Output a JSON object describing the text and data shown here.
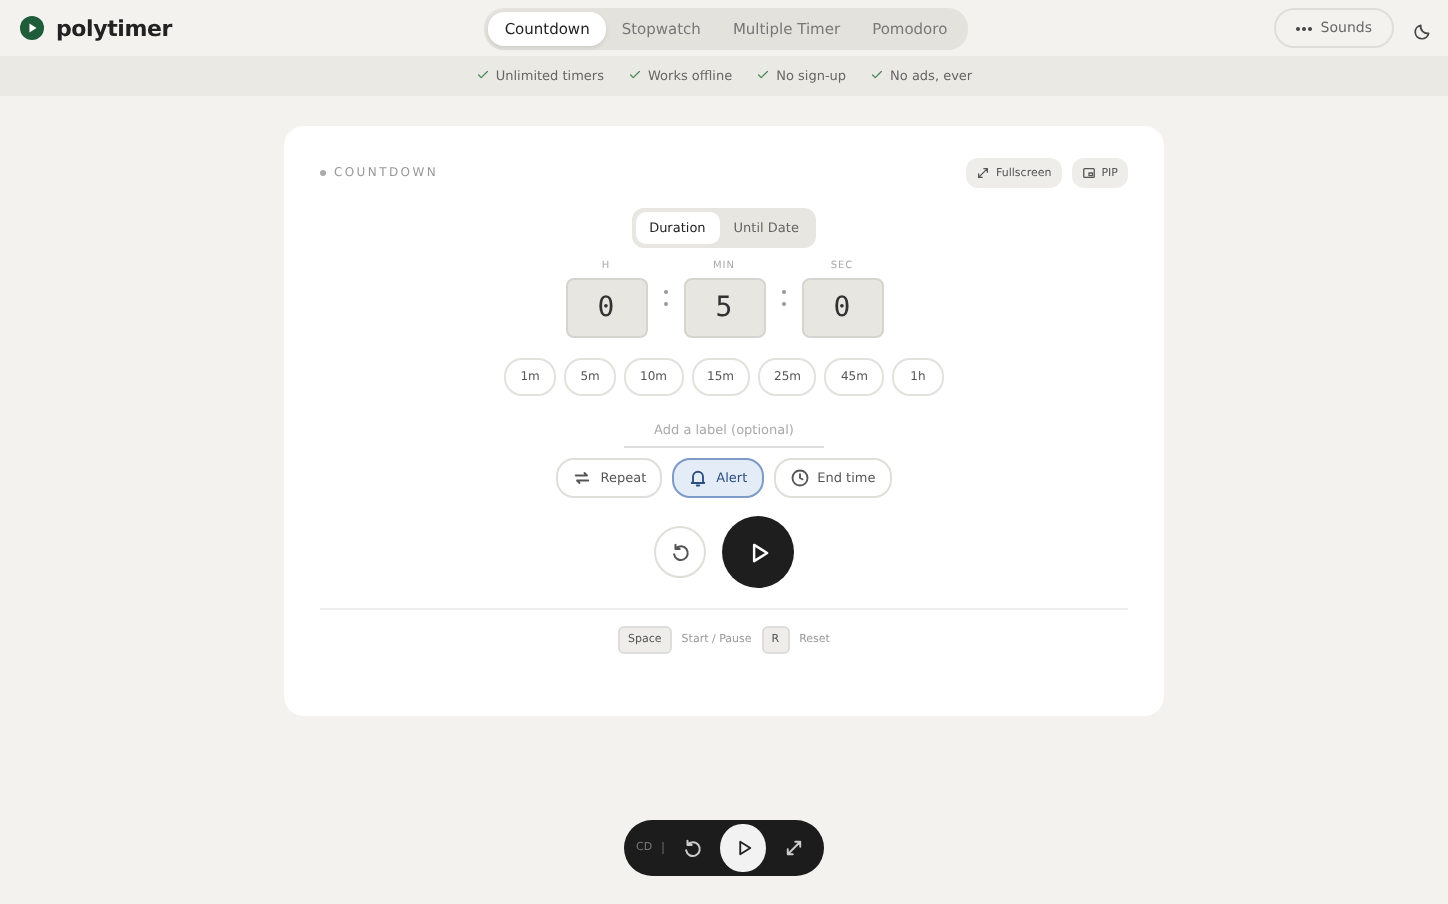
{
  "brand": {
    "name": "polytimer"
  },
  "nav_tabs": [
    {
      "label": "Countdown",
      "selected": true
    },
    {
      "label": "Stopwatch",
      "selected": false
    },
    {
      "label": "Multiple Timer",
      "selected": false
    },
    {
      "label": "Pomodoro",
      "selected": false
    }
  ],
  "sounds_button": {
    "label": "Sounds"
  },
  "features": [
    "Unlimited timers",
    "Works offline",
    "No sign-up",
    "No ads, ever"
  ],
  "card": {
    "title": "COUNTDOWN",
    "fullscreen": "Fullscreen",
    "pip": "PIP",
    "modes": [
      {
        "label": "Duration",
        "selected": true
      },
      {
        "label": "Until Date",
        "selected": false
      }
    ],
    "fields": [
      {
        "label": "H",
        "value": "0"
      },
      {
        "label": "MIN",
        "value": "5"
      },
      {
        "label": "SEC",
        "value": "0"
      }
    ],
    "presets": [
      "1m",
      "5m",
      "10m",
      "15m",
      "25m",
      "45m",
      "1h"
    ],
    "label_field": {
      "placeholder": "Add a label (optional)"
    },
    "options": [
      {
        "kind": "repeat",
        "label": "Repeat",
        "on": false
      },
      {
        "kind": "alert",
        "label": "Alert",
        "on": true
      },
      {
        "kind": "clock",
        "label": "End time",
        "on": false
      }
    ],
    "shortcuts": [
      {
        "key": "Space",
        "action": "Start / Pause"
      },
      {
        "key": "R",
        "action": "Reset"
      }
    ]
  },
  "dock": {
    "label": "CD"
  }
}
